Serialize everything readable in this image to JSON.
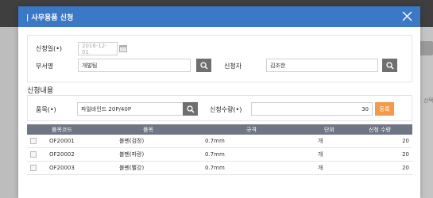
{
  "background": {
    "side_text": "선택"
  },
  "modal": {
    "title": "| 사무용품 신청",
    "close_icon": "close-icon"
  },
  "form": {
    "date_label": "신청일(•)",
    "date_value": "2016-12-01",
    "dept_label": "부서명",
    "dept_value": "개발팀",
    "applicant_label": "신청자",
    "applicant_value": "김조한"
  },
  "section": {
    "title": "신청내용",
    "item_label": "품목(•)",
    "item_value": "파일바인드 20P/40P",
    "qty_label": "신청수량(•)",
    "qty_value": "30",
    "register_label": "등록"
  },
  "table": {
    "headers": [
      "품목코드",
      "품목",
      "규격",
      "단위",
      "신청 수량"
    ],
    "rows": [
      {
        "code": "OF20001",
        "name": "볼펜(검정)",
        "spec": "0.7mm",
        "unit": "개",
        "qty": "20"
      },
      {
        "code": "OF20002",
        "name": "볼펜(파랑)",
        "spec": "0.7mm",
        "unit": "개",
        "qty": "20"
      },
      {
        "code": "OF20003",
        "name": "볼펜(빨강)",
        "spec": "0.7mm",
        "unit": "개",
        "qty": "20"
      }
    ]
  },
  "colors": {
    "header_blue": "#3b79c6",
    "table_header": "#6e7585",
    "register_orange": "#f29b4c",
    "search_btn": "#6f6f6f"
  }
}
